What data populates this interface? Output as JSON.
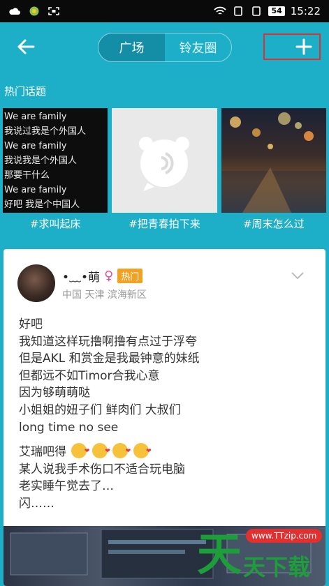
{
  "status_bar": {
    "battery": "54",
    "time": "15:22",
    "icons": [
      "cloud-icon",
      "app-icon",
      "screenshot-icon",
      "wifi-icon",
      "sim1-icon",
      "sim2-icon",
      "battery-icon"
    ]
  },
  "header": {
    "back_icon": "arrow-left-icon",
    "tabs": [
      {
        "label": "广场",
        "active": true
      },
      {
        "label": "铃友圈",
        "active": false
      }
    ],
    "add_icon": "plus-icon",
    "highlight_color": "#E0302F"
  },
  "topics": {
    "title": "热门话题",
    "items": [
      {
        "caption": "#求叫起床",
        "lyrics": [
          "We are family",
          "我说过我是个外国人",
          "We are family",
          "我说我是个外国人",
          "那要干什么",
          "We are family",
          "好吧 我是个中国人"
        ]
      },
      {
        "caption": "#把青春拍下来"
      },
      {
        "caption": "#周末怎么过"
      }
    ]
  },
  "post": {
    "username": "•﹏•萌",
    "gender_symbol": "♀",
    "badge": "热门",
    "location": "中国 天津 滨海新区",
    "lines_1": [
      "好吧",
      "我知道这样玩撸啊撸有点过于浮夸",
      "但是AKL 和赏金是我最钟意的妹纸",
      "但都远不如Timor合我心意",
      "因为够萌萌哒",
      "小姐姐的妞子们  鲜肉们  大叔们",
      "long time no see"
    ],
    "line_emoji": "艾瑞吧得",
    "emoji_count": 4,
    "lines_2": [
      "某人说我手术伤口不适合玩电脑",
      "老实睡午觉去了…",
      "闪……"
    ]
  },
  "watermark": {
    "big": "天",
    "url": "www.TTzip.com",
    "text": "天下载"
  },
  "colors": {
    "background": "#1EAFC8",
    "tab_active": "#148EA6",
    "badge": "#F2A222",
    "gender": "#E4519A"
  }
}
